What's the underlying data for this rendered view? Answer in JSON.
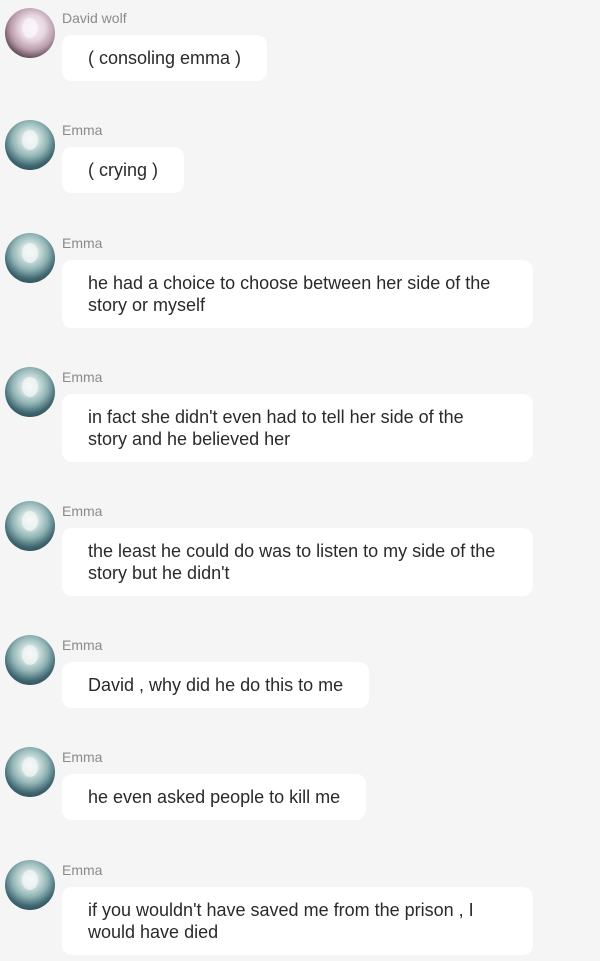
{
  "messages": [
    {
      "sender": "David wolf",
      "avatar": "david-avatar",
      "text": "( consoling emma )"
    },
    {
      "sender": "Emma",
      "avatar": "emma-avatar",
      "text": "( crying )"
    },
    {
      "sender": "Emma",
      "avatar": "emma-avatar",
      "text": "he had a choice to choose between her side of the story or myself"
    },
    {
      "sender": "Emma",
      "avatar": "emma-avatar",
      "text": "in fact she didn't even had to tell her side of the story and he believed her"
    },
    {
      "sender": "Emma",
      "avatar": "emma-avatar",
      "text": "the least he could do was to listen to my side of the story but he didn't"
    },
    {
      "sender": "Emma",
      "avatar": "emma-avatar",
      "text": "David , why did he do this to me"
    },
    {
      "sender": "Emma",
      "avatar": "emma-avatar",
      "text": "he even asked people to kill me"
    },
    {
      "sender": "Emma",
      "avatar": "emma-avatar",
      "text": "if you wouldn't have saved me from the prison , I would have died"
    }
  ]
}
